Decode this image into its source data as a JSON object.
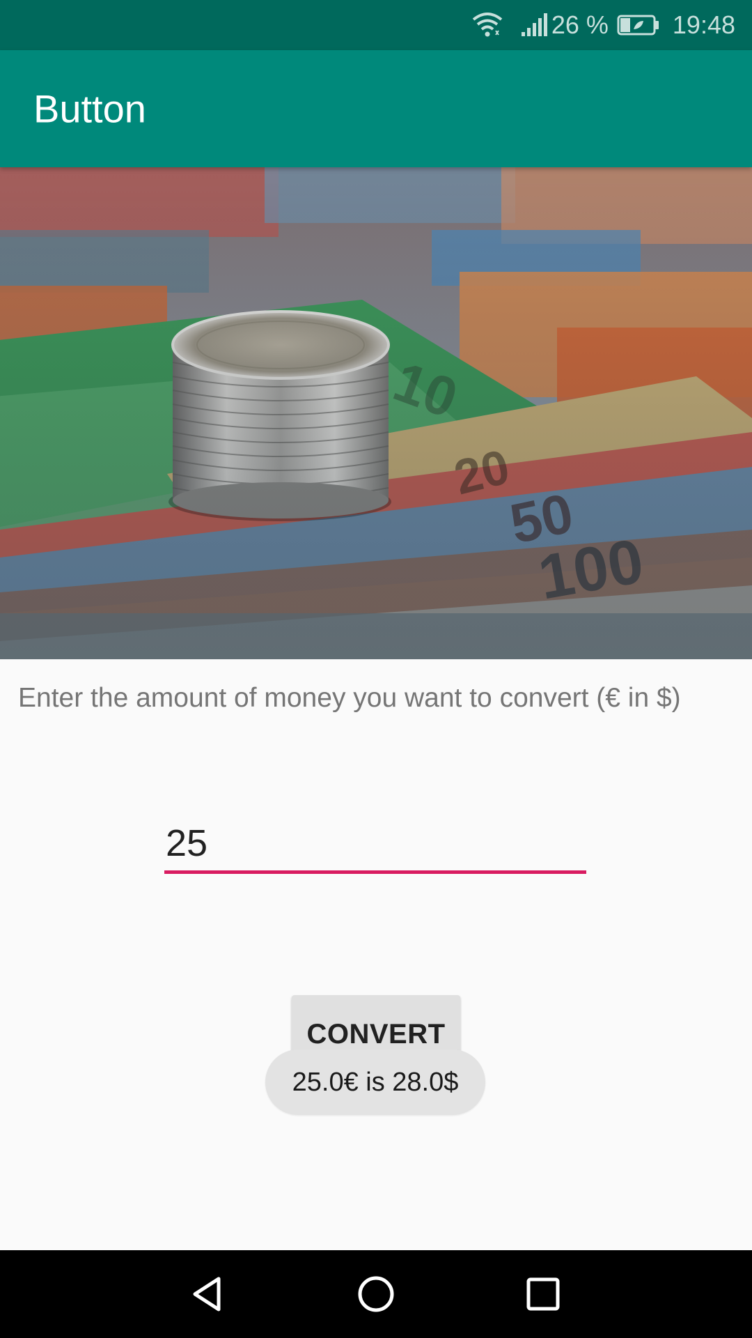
{
  "status_bar": {
    "battery_percent": "26 %",
    "time": "19:48",
    "icons": [
      "wifi-icon",
      "signal-icon",
      "battery-icon"
    ]
  },
  "app_bar": {
    "title": "Button",
    "color": "#00897b"
  },
  "hero_image": {
    "subject": "coin stack on banknotes"
  },
  "form": {
    "instruction": "Enter the amount of money you want to convert (€ in $)",
    "amount_value": "25",
    "accent_color": "#d81b60",
    "convert_label": "CONVERT"
  },
  "toast": {
    "message": "25.0€ is 28.0$"
  },
  "nav_bar": {
    "icons": [
      "back-icon",
      "home-icon",
      "recents-icon"
    ]
  }
}
